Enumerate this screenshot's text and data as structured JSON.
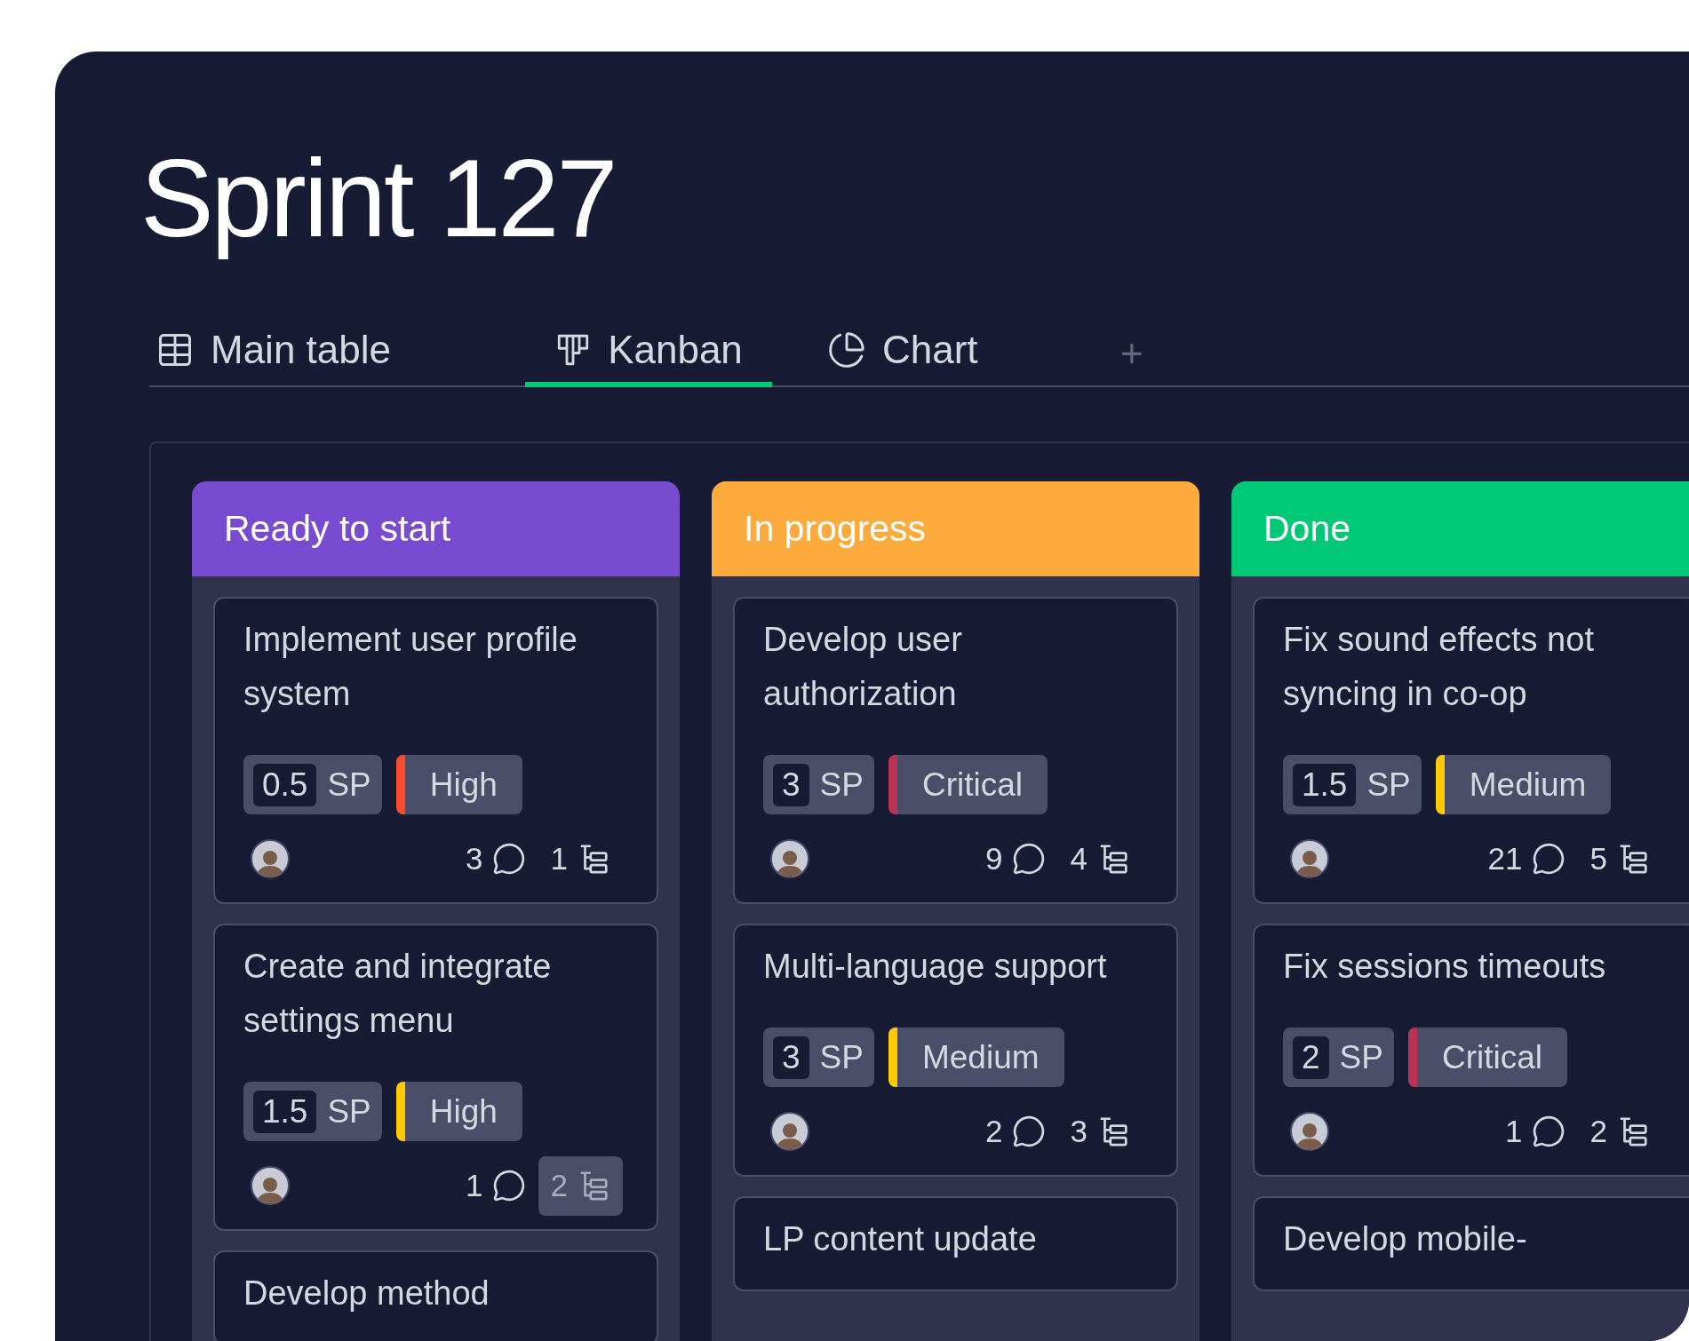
{
  "title": "Sprint 127",
  "tabs": [
    {
      "label": "Main table",
      "kind": "table",
      "selected": false
    },
    {
      "label": "Kanban",
      "kind": "kanban",
      "selected": true
    },
    {
      "label": "Chart",
      "kind": "chart",
      "selected": false
    }
  ],
  "add_tab": "+",
  "columns": [
    {
      "name": "Ready to start",
      "color": "#784bd1",
      "cards": [
        {
          "title": "Implement user profile system",
          "points": "0.5",
          "unit": "SP",
          "priority": {
            "label": "High",
            "color": "#fb4c2e"
          },
          "comments": "3",
          "subitems": "1",
          "subitems_highlighted": false
        },
        {
          "title": "Create and integrate settings menu",
          "points": "1.5",
          "unit": "SP",
          "priority": {
            "label": "High",
            "color": "#ffcb00"
          },
          "comments": "1",
          "subitems": "2",
          "subitems_highlighted": true
        },
        {
          "title": "Develop method"
        }
      ]
    },
    {
      "name": "In progress",
      "color": "#fdab3d",
      "cards": [
        {
          "title": "Develop user authorization",
          "points": "3",
          "unit": "SP",
          "priority": {
            "label": "Critical",
            "color": "#bb3354"
          },
          "comments": "9",
          "subitems": "4",
          "subitems_highlighted": false
        },
        {
          "title": "Multi-language support",
          "points": "3",
          "unit": "SP",
          "priority": {
            "label": "Medium",
            "color": "#ffcb00"
          },
          "comments": "2",
          "subitems": "3",
          "subitems_highlighted": false
        },
        {
          "title": "LP content update"
        }
      ]
    },
    {
      "name": "Done",
      "color": "#00c875",
      "cards": [
        {
          "title": "Fix sound effects not syncing in co-op",
          "points": "1.5",
          "unit": "SP",
          "priority": {
            "label": "Medium",
            "color": "#ffcb00"
          },
          "comments": "21",
          "subitems": "5",
          "subitems_highlighted": false
        },
        {
          "title": "Fix sessions timeouts",
          "points": "2",
          "unit": "SP",
          "priority": {
            "label": "Critical",
            "color": "#bb3354"
          },
          "comments": "1",
          "subitems": "2",
          "subitems_highlighted": false
        },
        {
          "title": "Develop mobile-"
        }
      ]
    }
  ]
}
